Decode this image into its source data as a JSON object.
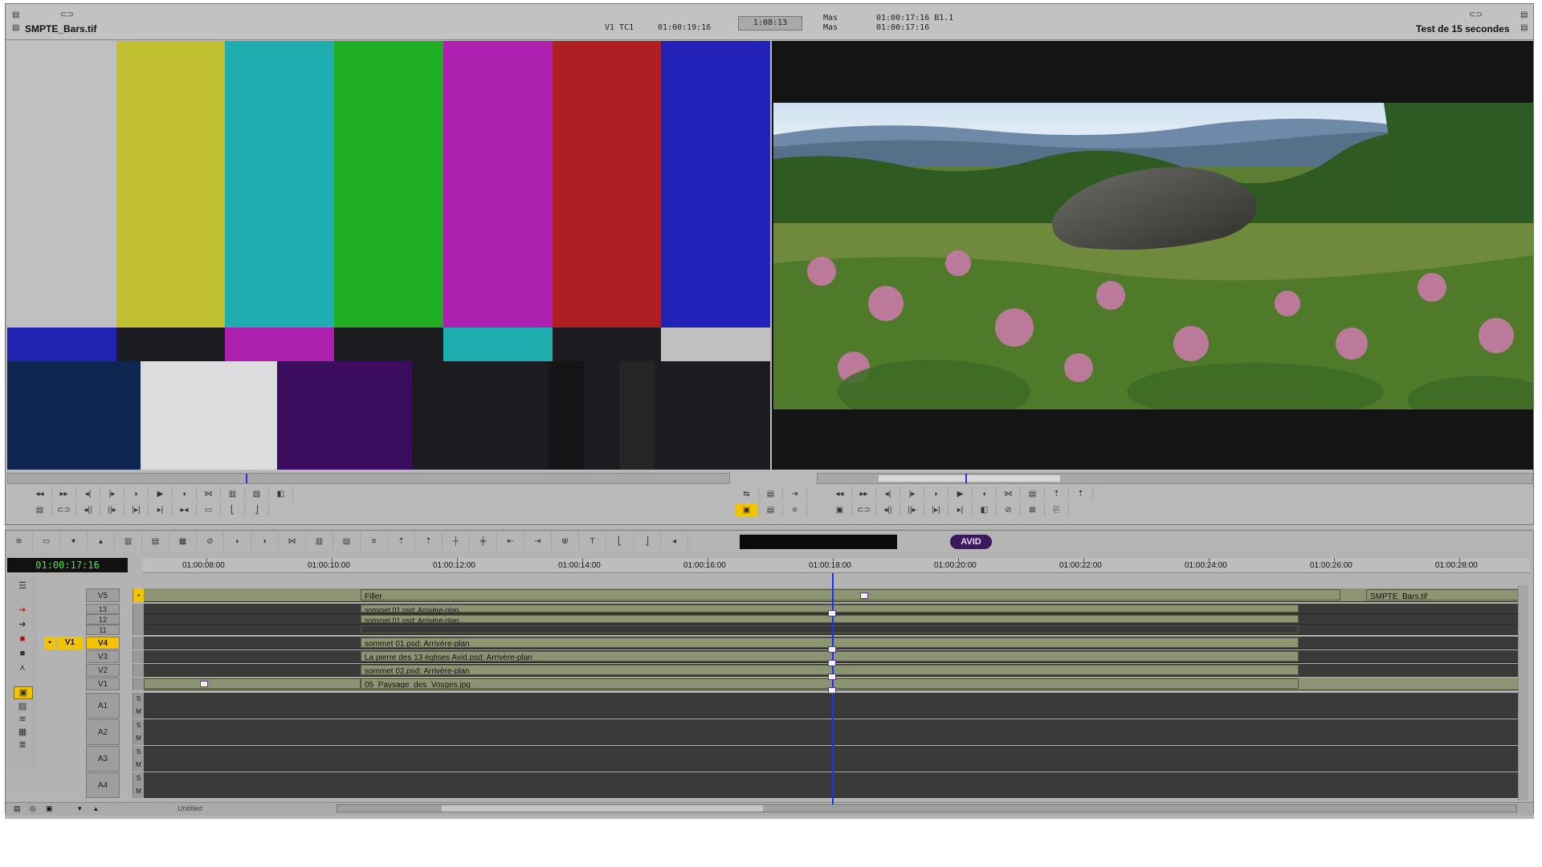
{
  "source": {
    "clip_name": "SMPTE_Bars.tif",
    "track_label": "V1 TC1",
    "timecode": "01:00:19:16",
    "duration": "1:08:13",
    "bars_top_colors": [
      "#c0c0c0",
      "#c0c030",
      "#1fadb0",
      "#20ae24",
      "#ae20b0",
      "#ad1f23",
      "#2222b8"
    ],
    "bars_mid_colors": [
      "#2222b0",
      "#1c1c20",
      "#ad1fae",
      "#1c1c20",
      "#1fadb0",
      "#1c1c20",
      "#c0c0c0"
    ]
  },
  "record": {
    "sequence_name": "Test de 15 secondes",
    "mas_label_1": "Mas",
    "mas_label_2": "Mas",
    "mas_tc_1": "01:00:17:16 B1.1",
    "mas_tc_2": "01:00:17:16"
  },
  "timeline": {
    "current_tc": "01:00:17:16",
    "ruler_ticks": [
      "01:00:08:00",
      "01:00:10:00",
      "01:00:12:00",
      "01:00:14:00",
      "01:00:16:00",
      "01:00:18:00",
      "01:00:20:00",
      "01:00:22:00",
      "01:00:24:00",
      "01:00:26:00",
      "01:00:28:00"
    ],
    "logo_text": "AVID",
    "bin_name": "Untitled",
    "tracks": [
      {
        "name": "V5",
        "clips": [
          {
            "label": "Filler"
          },
          {
            "label": "SMPTE_Bars.tif"
          }
        ]
      },
      {
        "name": "13",
        "clips": [
          {
            "label": "sommet 01.psd: Arrivère-plan"
          }
        ]
      },
      {
        "name": "12",
        "clips": [
          {
            "label": "sommet 01.psd: Arrivère-plan"
          }
        ]
      },
      {
        "name": "11",
        "clips": [
          {
            "label": ""
          }
        ]
      },
      {
        "name": "V4",
        "patch": "V1",
        "clips": [
          {
            "label": "sommet 01.psd: Arrivère-plan"
          }
        ]
      },
      {
        "name": "V3",
        "clips": [
          {
            "label": "La pierre des 13 églises Avid.psd: Arrivère-plan"
          }
        ]
      },
      {
        "name": "V2",
        "clips": [
          {
            "label": "sommet 02.psd: Arrivère-plan"
          }
        ]
      },
      {
        "name": "V1",
        "clips": [
          {
            "label": "05_Paysage_des_Vosges.jpg"
          }
        ]
      },
      {
        "name": "A1"
      },
      {
        "name": "A2"
      },
      {
        "name": "A3"
      },
      {
        "name": "A4"
      }
    ]
  },
  "icons": [
    "play-icon",
    "rewind-icon",
    "fast-forward-icon",
    "step-back-icon",
    "step-forward-icon",
    "mark-in-icon",
    "mark-out-icon",
    "splice-icon",
    "overwrite-icon",
    "lift-icon",
    "extract-icon",
    "avid-logo"
  ]
}
